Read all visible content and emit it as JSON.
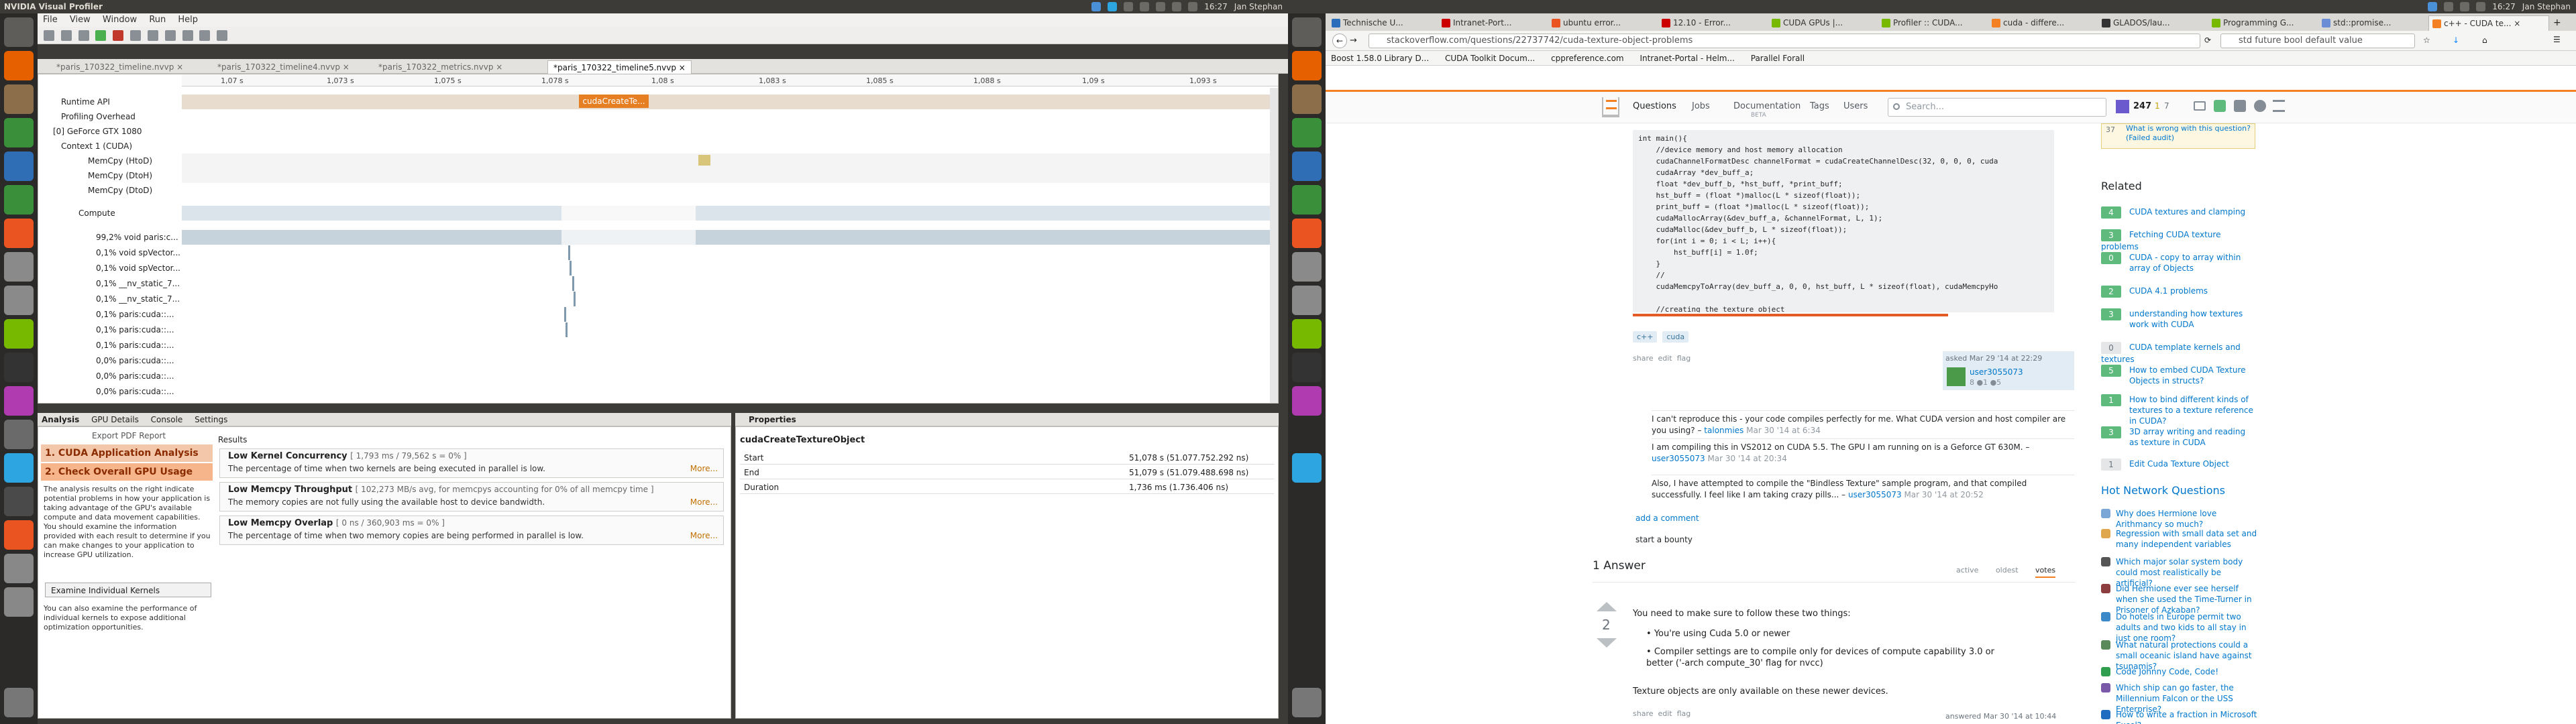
{
  "system": {
    "app_title": "NVIDIA Visual Profiler",
    "clock": "16:27",
    "user": "Jan Stephan"
  },
  "nvvp": {
    "menu": [
      "File",
      "View",
      "Window",
      "Run",
      "Help"
    ],
    "tabs": [
      "*paris_170322_timeline.nvvp",
      "*paris_170322_timeline4.nvvp",
      "*paris_170322_metrics.nvvp",
      "*paris_170322_timeline5.nvvp"
    ],
    "ruler": [
      "1,07 s",
      "1,073 s",
      "1,075 s",
      "1,078 s",
      "1,08 s",
      "1,083 s",
      "1,085 s",
      "1,088 s",
      "1,09 s",
      "1,093 s"
    ],
    "tooltip": "cudaCreateTe...",
    "rows": [
      "Runtime API",
      "Profiling Overhead",
      "[0] GeForce GTX 1080",
      "Context 1 (CUDA)",
      "MemCpy (HtoD)",
      "MemCpy (DtoH)",
      "MemCpy (DtoD)",
      "Compute",
      "99,2% void paris:c...",
      "0,1% void spVector...",
      "0,1% void spVector...",
      "0,1% __nv_static_7...",
      "0,1% __nv_static_7...",
      "0,1% paris:cuda::...",
      "0,1% paris:cuda::...",
      "0,1% paris:cuda::...",
      "0,0% paris:cuda::...",
      "0,0% paris:cuda::...",
      "0,0% paris:cuda::..."
    ],
    "analysis_tabs": [
      "Analysis",
      "GPU Details",
      "Console",
      "Settings"
    ],
    "export": "Export PDF Report",
    "steps": [
      "1. CUDA Application Analysis",
      "2. Check Overall GPU Usage"
    ],
    "analysis_text": "The analysis results on the right indicate potential problems in how your application is taking advantage of the GPU's available compute and data movement capabilities. You should examine the information provided with each result to determine if you can make changes to your application to increase GPU utilization.",
    "examine_btn": "Examine Individual Kernels",
    "examine_text": "You can also examine the performance of individual kernels to expose additional optimization opportunities.",
    "results_label": "Results",
    "results": [
      {
        "title": "Low Kernel Concurrency",
        "meta": "[ 1,793 ms / 79,562 s = 0% ]",
        "desc": "The percentage of time when two kernels are being executed in parallel is low.",
        "more": "More..."
      },
      {
        "title": "Low Memcpy Throughput",
        "meta": "[ 102,273 MB/s avg, for memcpys accounting for 0% of all memcpy time ]",
        "desc": "The memory copies are not fully using the available host to device bandwidth.",
        "more": "More..."
      },
      {
        "title": "Low Memcpy Overlap",
        "meta": "[ 0 ns / 360,903 ms = 0% ]",
        "desc": "The percentage of time when two memory copies are being performed in parallel is low.",
        "more": "More..."
      }
    ],
    "properties": {
      "header": "Properties",
      "name": "cudaCreateTextureObject",
      "rows": [
        {
          "k": "Start",
          "v": "51,078 s (51.077.752.292 ns)"
        },
        {
          "k": "End",
          "v": "51,079 s (51.079.488.698 ns)"
        },
        {
          "k": "Duration",
          "v": "1,736 ms (1.736.406 ns)"
        }
      ]
    }
  },
  "firefox": {
    "tabs": [
      "Technische U...",
      "Intranet-Port...",
      "ubuntu error...",
      "12.10 - Error...",
      "CUDA GPUs |...",
      "Profiler :: CUDA...",
      "cuda - differe...",
      "GLADOS/lau...",
      "Programming G...",
      "std::promise...",
      "c++ - CUDA te..."
    ],
    "url": "stackoverflow.com/questions/22737742/cuda-texture-object-problems",
    "search": "std future bool default value",
    "bookmarks": [
      "Boost 1.58.0 Library D...",
      "CUDA Toolkit Docum...",
      "cppreference.com",
      "Intranet-Portal - Helm...",
      "Parallel Forall"
    ]
  },
  "so": {
    "nav": [
      "Questions",
      "Jobs",
      "Documentation",
      "Tags",
      "Users"
    ],
    "nav_beta": "BETA",
    "search_placeholder": "Search...",
    "rep": "247",
    "badge_gold": "1",
    "badge_silver": "7",
    "code": "int main(){\n    //device memory and host memory allocation\n    cudaChannelFormatDesc channelFormat = cudaCreateChannelDesc(32, 0, 0, 0, cuda\n    cudaArray *dev_buff_a;\n    float *dev_buff_b, *hst_buff, *print_buff;\n    hst_buff = (float *)malloc(L * sizeof(float));\n    print_buff = (float *)malloc(L * sizeof(float));\n    cudaMallocArray(&dev_buff_a, &channelFormat, L, 1);\n    cudaMalloc(&dev_buff_b, L * sizeof(float));\n    for(int i = 0; i < L; i++){\n        hst_buff[i] = 1.0f;\n    }\n    //\n    cudaMemcpyToArray(dev_buff_a, 0, 0, hst_buff, L * sizeof(float), cudaMemcpyHo\n\n    //creating the texture object",
    "tags": [
      "c++",
      "cuda"
    ],
    "post_actions": "share  edit  flag",
    "asked": "asked Mar 29 '14 at 22:29",
    "asker": "user3055073",
    "asker_meta": "8 ●1 ●5",
    "comments": [
      {
        "text": "I can't reproduce this - your code compiles perfectly for me. What CUDA version and host compiler are you using?",
        "user": "talonmies",
        "date": "Mar 30 '14 at 6:34"
      },
      {
        "text": "I am compiling this in VS2012 on CUDA 5.5. The GPU I am running on is a Geforce GT 630M.",
        "user": "user3055073",
        "date": "Mar 30 '14 at 20:34"
      },
      {
        "text": "Also, I have attempted to compile the \"Bindless Texture\" sample program, and that compiled successfully. I feel like I am taking crazy pills...",
        "user": "user3055073",
        "date": "Mar 30 '14 at 20:52"
      }
    ],
    "add_comment": "add a comment",
    "bounty": "start a bounty",
    "answers_count": "1 Answer",
    "sort": [
      "active",
      "oldest",
      "votes"
    ],
    "votes": "2",
    "answer_intro": "You need to make sure to follow these two things:",
    "answer_bullets": [
      "You're using Cuda 5.0 or newer",
      "Compiler settings are to compile only for devices of compute capability 3.0 or better ('-arch compute_30' flag for nvcc)"
    ],
    "answer_outro": "Texture objects are only available on these newer devices.",
    "answered": "answered Mar 30 '14 at 10:44",
    "linked_num": "37",
    "linked_text": "What is wrong with this question? (Failed audit)",
    "related_title": "Related",
    "related": [
      {
        "n": "4",
        "t": "CUDA textures and clamping"
      },
      {
        "n": "3",
        "t": "Fetching CUDA texture problems"
      },
      {
        "n": "0",
        "t": "CUDA - copy to array within array of Objects"
      },
      {
        "n": "2",
        "t": "CUDA 4.1 problems"
      },
      {
        "n": "3",
        "t": "understanding how textures work with CUDA"
      },
      {
        "n": "0",
        "t": "CUDA template kernels and textures"
      },
      {
        "n": "5",
        "t": "How to embed CUDA Texture Objects in structs?"
      },
      {
        "n": "1",
        "t": "How to bind different kinds of textures to a texture reference in CUDA?"
      },
      {
        "n": "3",
        "t": "3D array writing and reading as texture in CUDA"
      },
      {
        "n": "1",
        "t": "Edit Cuda Texture Object"
      }
    ],
    "hnq_title": "Hot Network Questions",
    "hnq": [
      "Why does Hermione love Arithmancy so much?",
      "Regression with small data set and many independent variables",
      "Which major solar system body could most realistically be artificial?",
      "Did Hermione ever see herself when she used the Time-Turner in Prisoner of Azkaban?",
      "Do hotels in Europe permit two adults and two kids to all stay in just one room?",
      "What natural protections could a small oceanic island have against tsunamis?",
      "Code Johnny Code, Code!",
      "Which ship can go faster, the Millennium Falcon or the USS Enterprise?",
      "How to write a fraction in Microsoft Excel?"
    ]
  }
}
